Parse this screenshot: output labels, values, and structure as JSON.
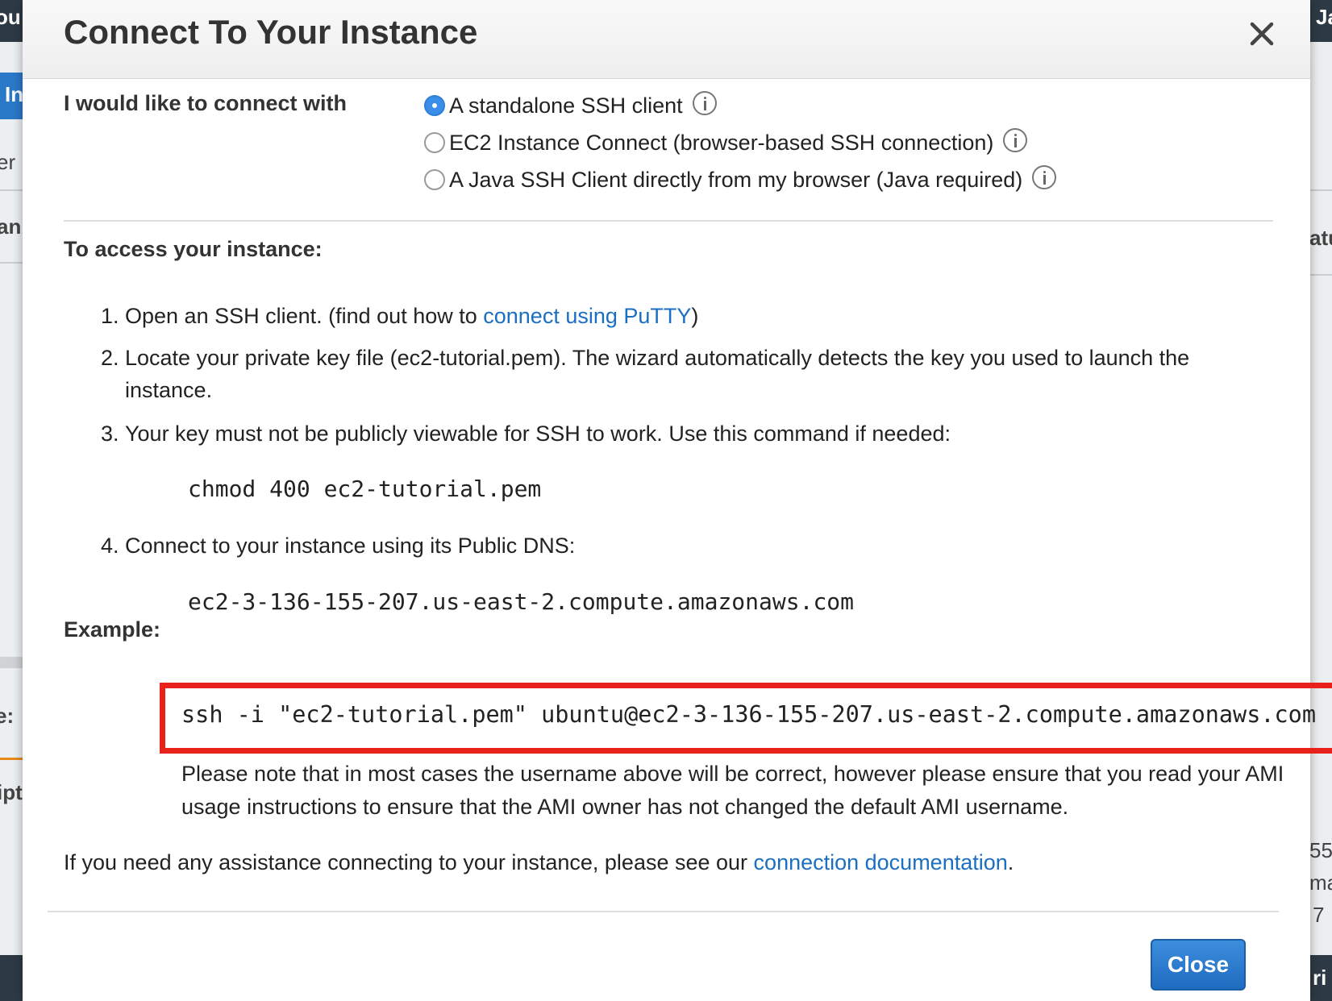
{
  "modal": {
    "title": "Connect To Your Instance",
    "connect_with_label": "I would like to connect with",
    "options": [
      {
        "label": "A standalone SSH client",
        "selected": true
      },
      {
        "label": "EC2 Instance Connect (browser-based SSH connection)",
        "selected": false
      },
      {
        "label": "A Java SSH Client directly from my browser (Java required)",
        "selected": false
      }
    ],
    "access_heading": "To access your instance:",
    "steps": [
      {
        "num": "1.",
        "text_before": "Open an SSH client. (find out how to ",
        "link": "connect using PuTTY",
        "text_after": ")"
      },
      {
        "num": "2.",
        "text": "Locate your private key file (ec2-tutorial.pem). The wizard automatically detects the key you used to launch the instance."
      },
      {
        "num": "3.",
        "text": "Your key must not be publicly viewable for SSH to work. Use this command if needed:",
        "code": "chmod 400 ec2-tutorial.pem"
      },
      {
        "num": "4.",
        "text": "Connect to your instance using its Public DNS:",
        "code": "ec2-3-136-155-207.us-east-2.compute.amazonaws.com"
      }
    ],
    "example_heading": "Example:",
    "example_command": "ssh -i \"ec2-tutorial.pem\" ubuntu@ec2-3-136-155-207.us-east-2.compute.amazonaws.com",
    "note": "Please note that in most cases the username above will be correct, however please ensure that you read your AMI usage instructions to ensure that the AMI owner has not changed the default AMI username.",
    "assistance": {
      "text": "If you need any assistance connecting to your instance, please see our ",
      "link": "connection documentation",
      "suffix": "."
    },
    "close_button": "Close"
  },
  "background": {
    "left_fragments": [
      "ou",
      "In",
      "er",
      "an",
      "e:",
      "ipt"
    ],
    "right_fragments": [
      "Ja",
      "atu",
      "55",
      "ma",
      "7",
      "ri"
    ]
  },
  "colors": {
    "accent": "#1a6fc2",
    "highlight_border": "#e8211b",
    "radio_selected": "#3b8ee8",
    "close_button": "#1f6cc0"
  }
}
